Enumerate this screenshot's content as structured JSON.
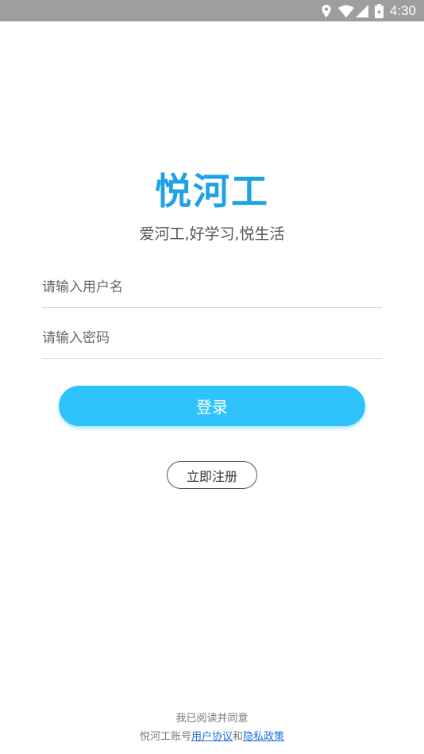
{
  "status_bar": {
    "time": "4:30",
    "icons": [
      "location-icon",
      "wifi-icon",
      "signal-icon",
      "battery-icon"
    ]
  },
  "app": {
    "title": "悦河工",
    "slogan": "爱河工,好学习,悦生活"
  },
  "form": {
    "username_placeholder": "请输入用户名",
    "password_placeholder": "请输入密码",
    "login_label": "登录",
    "register_label": "立即注册"
  },
  "agreement": {
    "line1": "我已阅读并同意",
    "prefix": "悦河工账号",
    "user_agreement": "用户协议",
    "conjunction": "和",
    "privacy_policy": "隐私政策"
  },
  "colors": {
    "accent": "#1ea1e6",
    "button": "#2ec4fb",
    "status_bar": "#9e9e9e",
    "link": "#1e6fd8"
  }
}
